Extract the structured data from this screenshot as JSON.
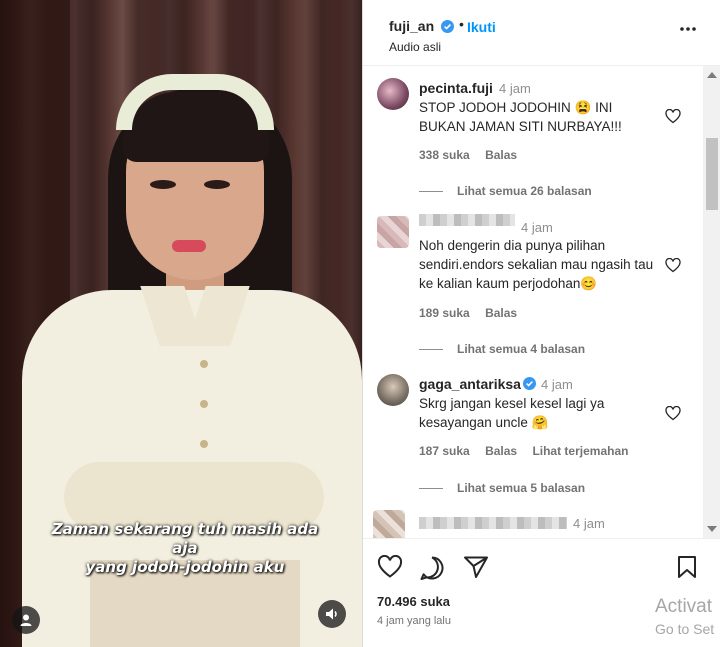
{
  "video": {
    "subtitle_line1": "Zaman sekarang tuh masih ada aja",
    "subtitle_line2": "yang jodoh-jodohin aku"
  },
  "header": {
    "username": "fuji_an",
    "separator": "•",
    "follow_label": "Ikuti",
    "audio_label": "Audio asli"
  },
  "comments": [
    {
      "username": "pecinta.fuji",
      "time": "4 jam",
      "text": "STOP JODOH JODOHIN 😫 INI BUKAN JAMAN SITI NURBAYA!!!",
      "likes": "338 suka",
      "reply_label": "Balas",
      "view_replies": "Lihat semua 26 balasan"
    },
    {
      "username": "",
      "time": "4 jam",
      "text": "Noh dengerin dia punya pilihan sendiri.endors sekalian mau ngasih tau ke kalian kaum perjodohan😊",
      "likes": "189 suka",
      "reply_label": "Balas",
      "view_replies": "Lihat semua 4 balasan"
    },
    {
      "username": "gaga_antariksa",
      "time": "4 jam",
      "text": "Skrg jangan kesel kesel lagi ya kesayangan uncle 🤗",
      "likes": "187 suka",
      "reply_label": "Balas",
      "translate_label": "Lihat terjemahan",
      "view_replies": "Lihat semua 5 balasan"
    },
    {
      "username": "",
      "time": "4 jam"
    }
  ],
  "footer": {
    "likes": "70.496 suka",
    "posted": "4 jam yang lalu"
  },
  "watermark": {
    "line1": "Activat",
    "line2": "Go to Set"
  },
  "colors": {
    "link": "#0095f6",
    "verified": "#3897f0"
  }
}
